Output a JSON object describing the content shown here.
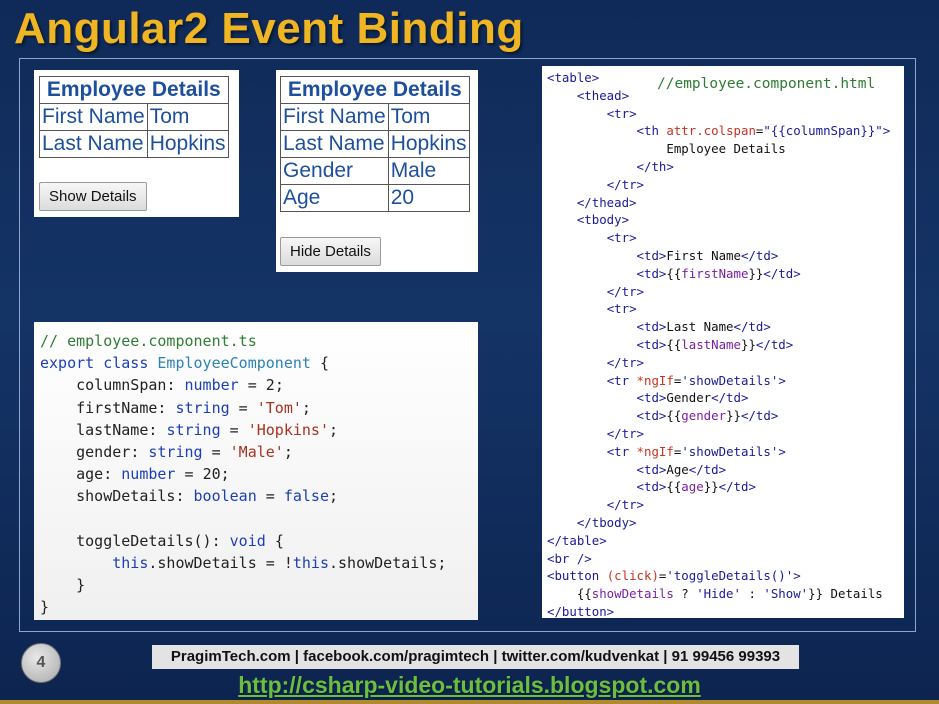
{
  "slide": {
    "title": "Angular2 Event Binding",
    "page_number": "4",
    "footer": "PragimTech.com | facebook.com/pragimtech | twitter.com/kudvenkat | 91 99456 99393",
    "url": "http://csharp-video-tutorials.blogspot.com"
  },
  "demo_collapsed": {
    "header": "Employee Details",
    "rows": [
      [
        "First Name",
        "Tom"
      ],
      [
        "Last Name",
        "Hopkins"
      ]
    ],
    "button": "Show Details"
  },
  "demo_expanded": {
    "header": "Employee Details",
    "rows": [
      [
        "First Name",
        "Tom"
      ],
      [
        "Last Name",
        "Hopkins"
      ],
      [
        "Gender",
        "Male"
      ],
      [
        "Age",
        "20"
      ]
    ],
    "button": "Hide Details"
  },
  "ts_code": {
    "comment": "// employee.component.ts",
    "kw_export": "export",
    "kw_class": "class",
    "class_name": "EmployeeComponent",
    "open_brace": "{",
    "close_brace": "}",
    "fields": [
      {
        "name": "columnSpan",
        "type": "number",
        "value": "2"
      },
      {
        "name": "firstName",
        "type": "string",
        "value": "'Tom'"
      },
      {
        "name": "lastName",
        "type": "string",
        "value": "'Hopkins'"
      },
      {
        "name": "gender",
        "type": "string",
        "value": "'Male'"
      },
      {
        "name": "age",
        "type": "number",
        "value": "20"
      },
      {
        "name": "showDetails",
        "type": "boolean",
        "value": "false"
      }
    ],
    "method_name": "toggleDetails",
    "method_type": "void",
    "kw_this": "this",
    "prop": "showDetails"
  },
  "html_code": {
    "comment": "//employee.component.html",
    "caption": "Employee Details",
    "colspan_expr": "{{columnSpan}}",
    "ngif_attr": "*ngIf",
    "ngif_value": "'showDetails'",
    "labels": [
      "First Name",
      "Last Name",
      "Gender",
      "Age"
    ],
    "bindings": [
      "firstName",
      "lastName",
      "gender",
      "age"
    ],
    "click_value": "'toggleDetails()'",
    "button_prop": "showDetails",
    "hide_text": "'Hide'",
    "show_text": "'Show'",
    "button_suffix": "Details"
  }
}
